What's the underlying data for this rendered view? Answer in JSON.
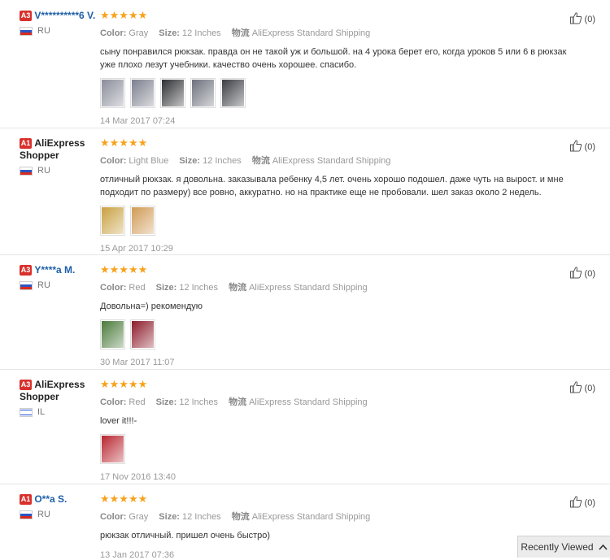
{
  "reviews": [
    {
      "level": "A3",
      "name": "V**********6 V.",
      "name_color": "blue",
      "country": "RU",
      "flag": "ru",
      "color_label": "Color:",
      "color": "Gray",
      "size_label": "Size:",
      "size": "12 Inches",
      "ship_label": "物流",
      "ship": "AliExpress Standard Shipping",
      "text": "сыну понравился рюкзак. правда он не такой уж и большой. на 4 урока берет его, когда уроков 5 или 6 в рюкзак уже плохо лезут учебники. качество очень хорошее. спасибо.",
      "photos": [
        "#8a8d9a",
        "#7c7f8e",
        "#2e2f33",
        "#6d707c",
        "#3a3c42"
      ],
      "date": "14 Mar 2017 07:24",
      "likes": "(0)"
    },
    {
      "level": "A1",
      "name": "AliExpress Shopper",
      "name_color": "black",
      "country": "RU",
      "flag": "ru",
      "color_label": "Color:",
      "color": "Light Blue",
      "size_label": "Size:",
      "size": "12 Inches",
      "ship_label": "物流",
      "ship": "AliExpress Standard Shipping",
      "text": "отличный рюкзак. я довольна. заказывала ребенку 4,5 лет. очень хорошо подошел. даже чуть на вырост. и мне подходит по размеру) все ровно, аккуратно. но на практике еще не пробовали. шел заказ около 2 недель.",
      "photos": [
        "#c8a040",
        "#d09a55"
      ],
      "date": "15 Apr 2017 10:29",
      "likes": "(0)"
    },
    {
      "level": "A3",
      "name": "Y****a M.",
      "name_color": "blue",
      "country": "RU",
      "flag": "ru",
      "color_label": "Color:",
      "color": "Red",
      "size_label": "Size:",
      "size": "12 Inches",
      "ship_label": "物流",
      "ship": "AliExpress Standard Shipping",
      "text": "Довольна=) рекомендую",
      "photos": [
        "#4a7a3a",
        "#8c1b2a"
      ],
      "date": "30 Mar 2017 11:07",
      "likes": "(0)"
    },
    {
      "level": "A3",
      "name": "AliExpress Shopper",
      "name_color": "black",
      "country": "IL",
      "flag": "il",
      "color_label": "Color:",
      "color": "Red",
      "size_label": "Size:",
      "size": "12 Inches",
      "ship_label": "物流",
      "ship": "AliExpress Standard Shipping",
      "text": "lover it!!!-",
      "photos": [
        "#b8252f"
      ],
      "date": "17 Nov 2016 13:40",
      "likes": "(0)"
    },
    {
      "level": "A1",
      "name": "O**a S.",
      "name_color": "blue",
      "country": "RU",
      "flag": "ru",
      "color_label": "Color:",
      "color": "Gray",
      "size_label": "Size:",
      "size": "12 Inches",
      "ship_label": "物流",
      "ship": "AliExpress Standard Shipping",
      "text": "рюкзак отличный. пришел очень быстро)",
      "photos": [],
      "date": "13 Jan 2017 07:36",
      "likes": "(0)"
    }
  ],
  "stars": "★★★★★",
  "recently_viewed": "Recently Viewed",
  "icons": {
    "like": "thumbs-up-icon",
    "recent": "chevron-up-icon"
  },
  "colors": {
    "star": "#f7a21b",
    "level_badge": "#d9302c",
    "username": "#1e5fa8"
  }
}
